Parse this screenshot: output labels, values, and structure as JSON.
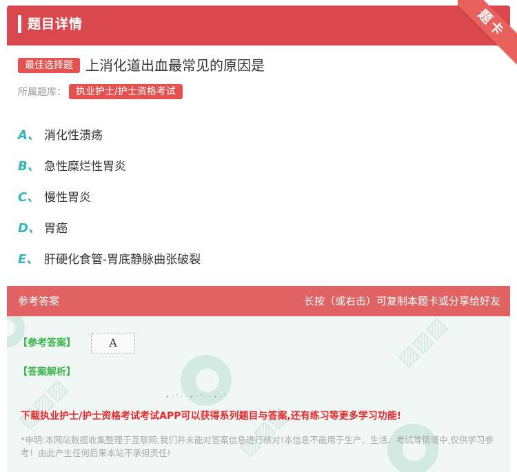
{
  "header": {
    "title": "题目详情",
    "corner_label": "题卡"
  },
  "question": {
    "type_tag": "最佳选择题",
    "text": "上消化道出血最常见的原因是",
    "bank_label": "所属题库：",
    "bank_name": "执业护士/护士资格考试"
  },
  "options": [
    {
      "letter": "A、",
      "text": "消化性溃疡"
    },
    {
      "letter": "B、",
      "text": "急性糜烂性胃炎"
    },
    {
      "letter": "C、",
      "text": "慢性胃炎"
    },
    {
      "letter": "D、",
      "text": "胃癌"
    },
    {
      "letter": "E、",
      "text": "肝硬化食管-胃底静脉曲张破裂"
    }
  ],
  "answer_section": {
    "title": "参考答案",
    "hint": "长按（或右击）可复制本题卡或分享给好友",
    "answer_label": "【参考答案】",
    "answer_value": "A",
    "analysis_label": "【答案解析】",
    "promo": "下载执业护士/护士资格考试考试APP可以获得系列题目与答案,还有练习等更多学习功能!",
    "disclaimer": "*申明:本网站数据收集整理于互联网,我们并未能对答案信息进行核对!本信息不能用于生产、生活、考试等情境中,仅供学习参考！由此产生任何后果本站不承担责任!"
  },
  "colors": {
    "header_red": "#d9484c",
    "tag_red": "#e4514f",
    "option_letter": "#32b4be",
    "answer_green": "#3ab54a",
    "promo_red": "#e8292c"
  }
}
